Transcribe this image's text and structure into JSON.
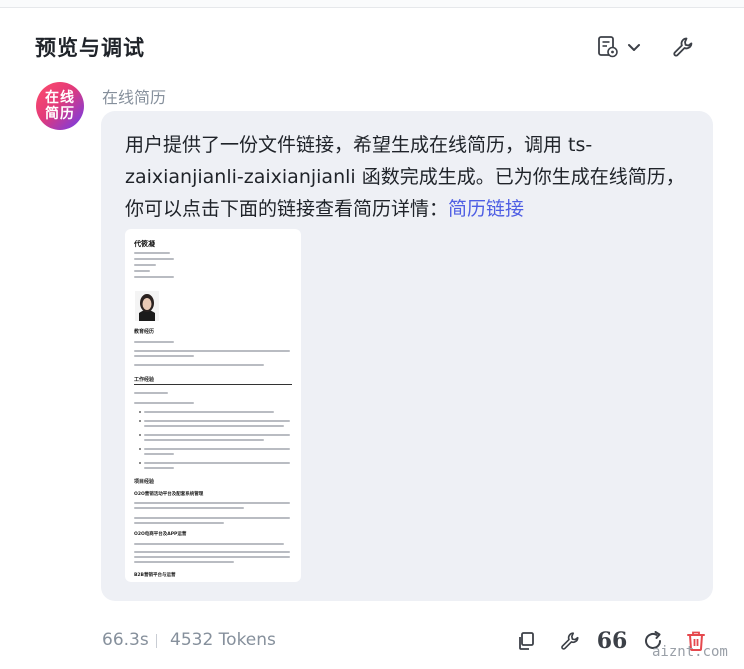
{
  "header": {
    "title": "预览与调试",
    "notes_icon": "notes-with-gear-icon",
    "dropdown_icon": "chevron-down-icon",
    "tools_icon": "wrench-icon"
  },
  "bot": {
    "avatar_line1": "在线",
    "avatar_line2": "简历",
    "name": "在线简历"
  },
  "message": {
    "text": "用户提供了一份文件链接，希望生成在线简历，调用 ts-zaixianjianli-zaixianjianli 函数完成生成。已为你生成在线简历，你可以点击下面的链接查看简历详情：",
    "link_label": "简历链接",
    "link_color": "#4e5ee4"
  },
  "resume_preview": {
    "name": "代筱凝",
    "section_education": "教育经历",
    "section_work": "工作经验",
    "section_projects": "项目经验",
    "project_1": "O2O营销活动平台及配套系统管理",
    "project_2": "O2O电商平台及APP运营",
    "project_3": "B2B营销平台与运营"
  },
  "footer": {
    "time": "66.3s",
    "tokens": "4532 Tokens",
    "icons": [
      "copy-icon",
      "wrench-icon",
      "quote-icon",
      "regenerate-icon",
      "delete-icon"
    ],
    "quote_glyph": "66",
    "delete_color": "#e5484d"
  },
  "watermark": "aiznt.com"
}
